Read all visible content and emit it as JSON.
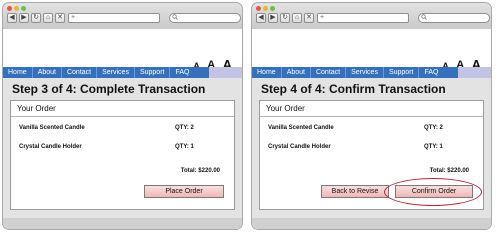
{
  "browser": {
    "nav_buttons": [
      "◀",
      "▶",
      "↻",
      "⌂",
      "✕"
    ],
    "address": "+",
    "search_icon": "search-icon"
  },
  "site": {
    "font_sizes": [
      "A",
      "A",
      "A"
    ],
    "menu": [
      "Home",
      "About",
      "Contact",
      "Services",
      "Support",
      "FAQ"
    ]
  },
  "screens": [
    {
      "step_title": "Step 3 of 4: Complete Transaction",
      "order_heading": "Your Order",
      "items": [
        {
          "name": "Vanilla Scented Candle",
          "qty": "QTY: 2"
        },
        {
          "name": "Crystal Candle Holder",
          "qty": "QTY: 1"
        }
      ],
      "total": "Total: $220.00",
      "primary_button": "Place Order"
    },
    {
      "step_title": "Step 4 of 4: Confirm Transaction",
      "order_heading": "Your Order",
      "items": [
        {
          "name": "Vanilla Scented Candle",
          "qty": "QTY: 2"
        },
        {
          "name": "Crystal Candle Holder",
          "qty": "QTY: 1"
        }
      ],
      "total": "Total: $220.00",
      "secondary_button": "Back to Revise",
      "primary_button": "Confirm Order",
      "highlight_color": "#b8262f"
    }
  ]
}
